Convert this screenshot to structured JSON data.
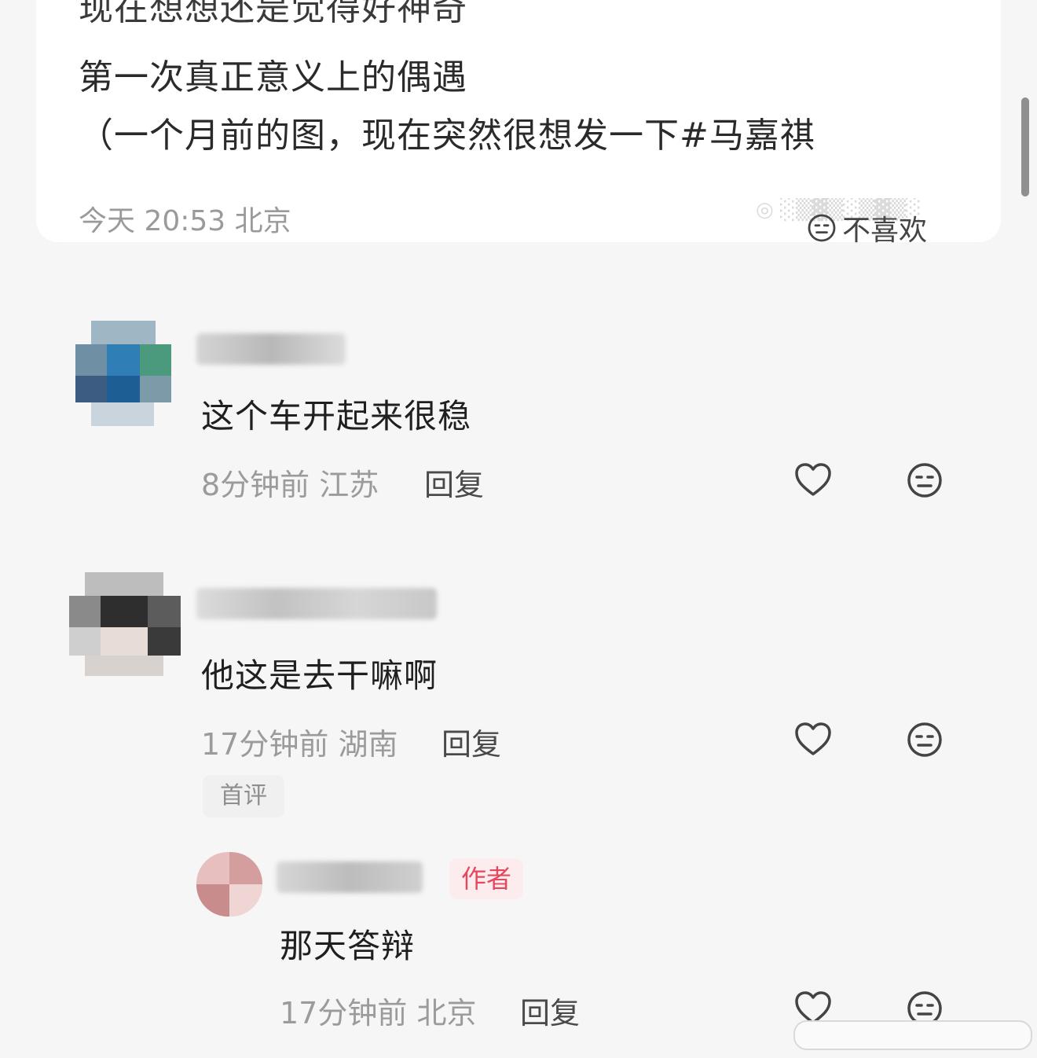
{
  "post": {
    "line0": "现在想想还是觉得好神奇",
    "line1": "第一次真正意义上的偶遇",
    "line2": "（一个月前的图，现在突然很想发一下#马嘉祺",
    "time": "今天 20:53",
    "location": "北京",
    "dislike_label": "不喜欢"
  },
  "comments": [
    {
      "text": "这个车开起来很稳",
      "time": "8分钟前",
      "location": "江苏",
      "reply_label": "回复"
    },
    {
      "text": "他这是去干嘛啊",
      "time": "17分钟前",
      "location": "湖南",
      "reply_label": "回复",
      "badge": "首评"
    }
  ],
  "reply": {
    "badge": "作者",
    "text": "那天答辩",
    "time": "17分钟前",
    "location": "北京",
    "reply_label": "回复"
  },
  "icons": {
    "like": "heart-outline-icon",
    "dislike": "neutral-face-icon"
  }
}
